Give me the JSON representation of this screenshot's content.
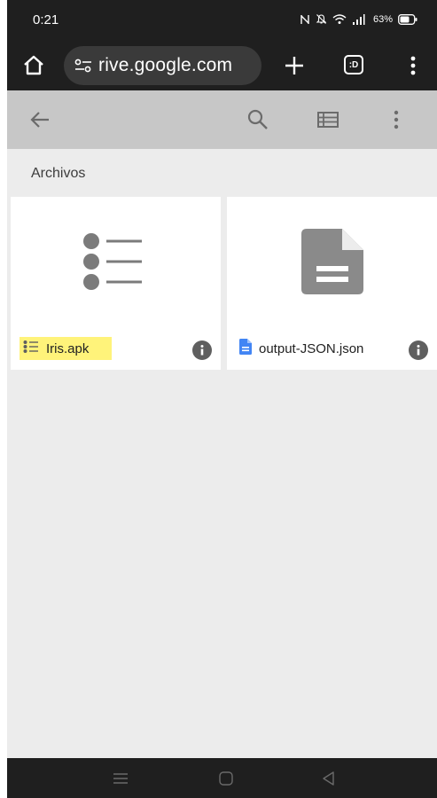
{
  "status_bar": {
    "time": "0:21",
    "battery_percent": "63%",
    "icons": [
      "nfc-icon",
      "mute-icon",
      "wifi-icon",
      "signal-icon",
      "battery-icon"
    ]
  },
  "browser": {
    "url": "rive.google.com",
    "tabs_label": ":D",
    "icons": [
      "home-icon",
      "site-settings-icon",
      "plus-icon",
      "tabs-icon",
      "more-vert-icon"
    ]
  },
  "toolbar": {
    "icons": [
      "back-arrow-icon",
      "search-icon",
      "list-view-icon",
      "more-vert-icon"
    ]
  },
  "section": {
    "title": "Archivos"
  },
  "files": [
    {
      "name": "Iris.apk",
      "icon": "list-icon",
      "highlighted": true
    },
    {
      "name": "output-JSON.json",
      "icon": "document-icon",
      "highlighted": false
    }
  ],
  "colors": {
    "dark_bar": "#1f1f1f",
    "toolbar": "#c7c7c7",
    "background": "#ececec",
    "highlight": "#fff37a",
    "doc_blue": "#4285f4",
    "icon_grey": "#8a8a8a"
  },
  "nav_bar": {
    "icons": [
      "recent-apps-icon",
      "home-nav-icon",
      "back-nav-icon"
    ]
  }
}
